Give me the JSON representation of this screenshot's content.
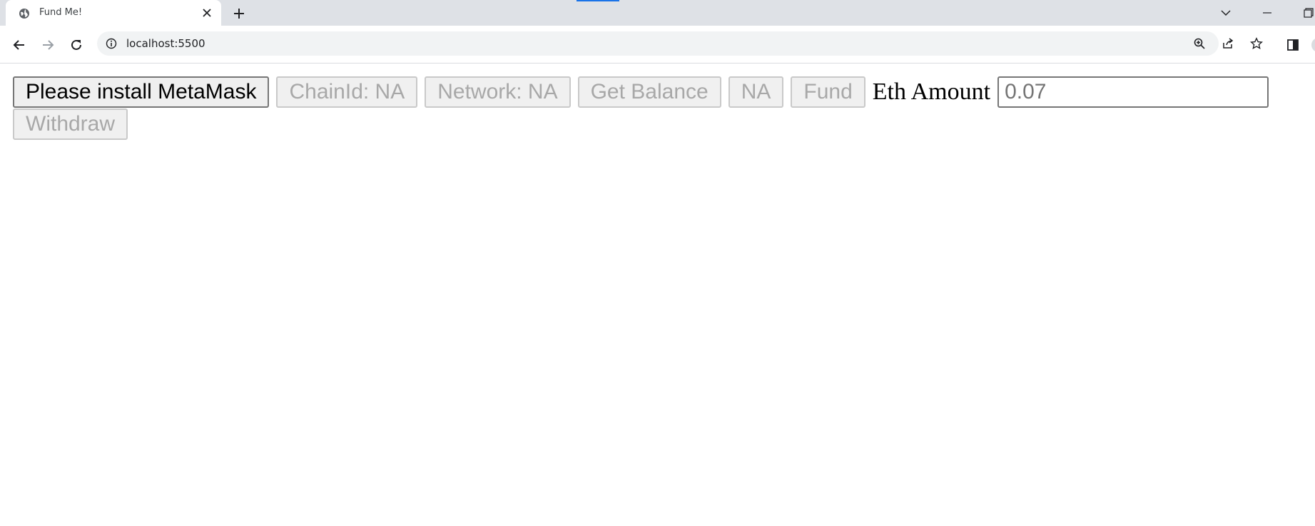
{
  "browser": {
    "tab": {
      "title": "Fund Me!",
      "favicon": "globe-icon",
      "close_icon": "close-icon"
    },
    "new_tab_icon": "plus-icon",
    "window_controls": [
      "tabs-search-icon",
      "minimize-icon",
      "restore-icon"
    ],
    "address_bar": {
      "url": "localhost:5500",
      "info_icon": "info-icon"
    },
    "toolbar_icons": [
      "zoom-icon",
      "share-icon",
      "star-icon",
      "side-panel-icon"
    ]
  },
  "page": {
    "connect_button": "Please install MetaMask",
    "chain_id_button": "ChainId: NA",
    "network_button": "Network: NA",
    "get_balance_button": "Get Balance",
    "balance_button": "NA",
    "fund_button": "Fund",
    "eth_amount_label": "Eth Amount",
    "eth_amount_placeholder": "0.07",
    "withdraw_button": "Withdraw"
  },
  "colors": {
    "tabstrip_bg": "#dee1e6",
    "accent": "#1a73e8",
    "disabled_text": "#a8a8a8"
  }
}
